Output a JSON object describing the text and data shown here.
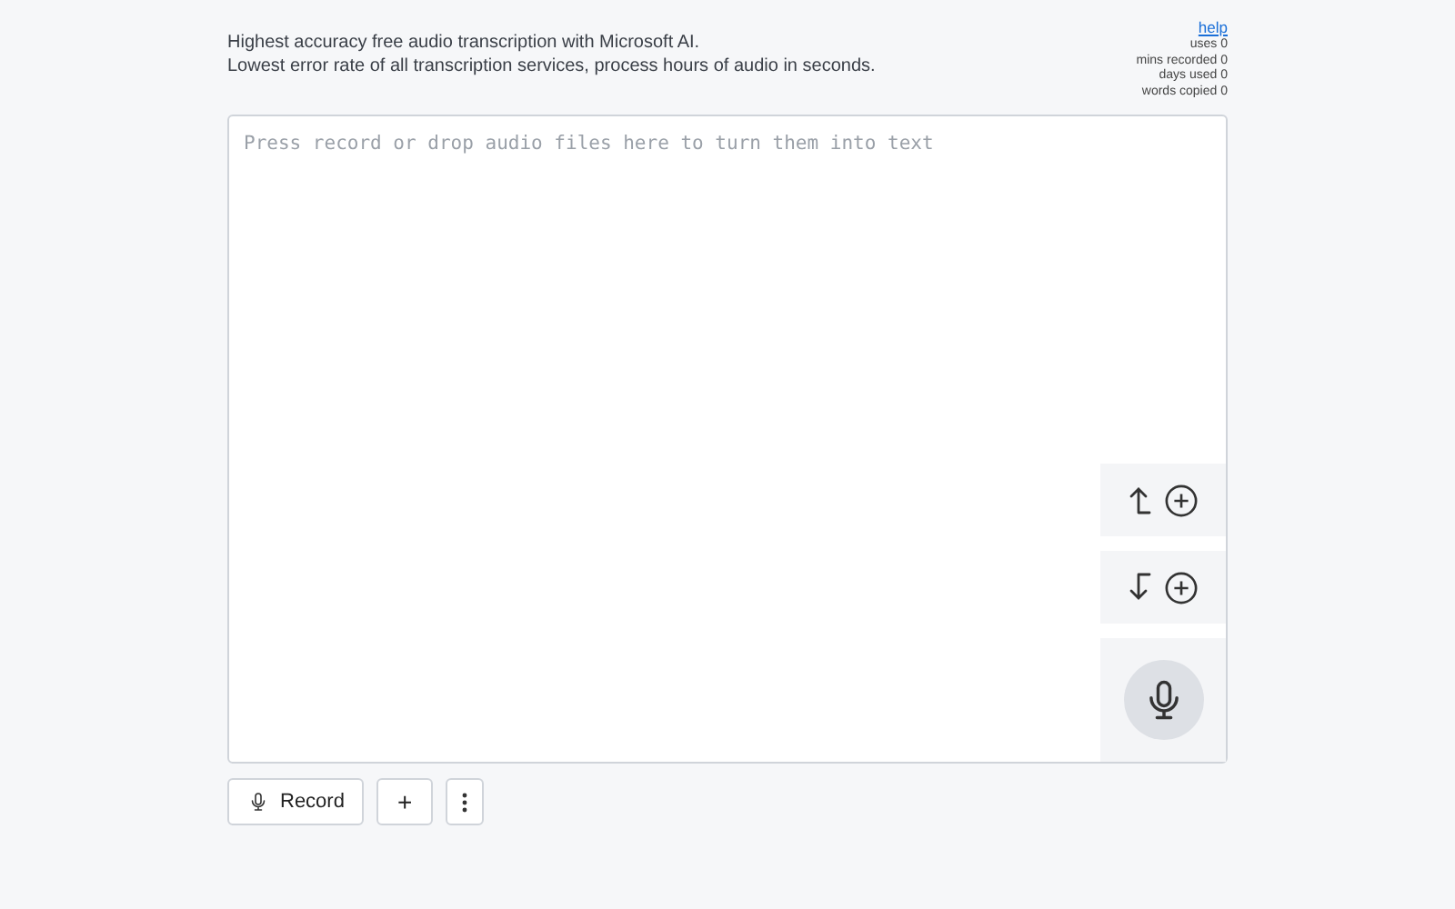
{
  "intro": [
    "Highest accuracy free audio transcription with Microsoft AI.",
    "Lowest error rate of all transcription services, process hours of audio in seconds."
  ],
  "help_link": "help",
  "stats": [
    {
      "label": "uses",
      "value": "0"
    },
    {
      "label": "mins recorded",
      "value": "0"
    },
    {
      "label": "days used",
      "value": "0"
    },
    {
      "label": "words copied",
      "value": "0"
    }
  ],
  "editor": {
    "placeholder": "Press record or drop audio files here to turn them into text"
  },
  "toolbar": {
    "record_label": "Record",
    "add_label": "+"
  }
}
